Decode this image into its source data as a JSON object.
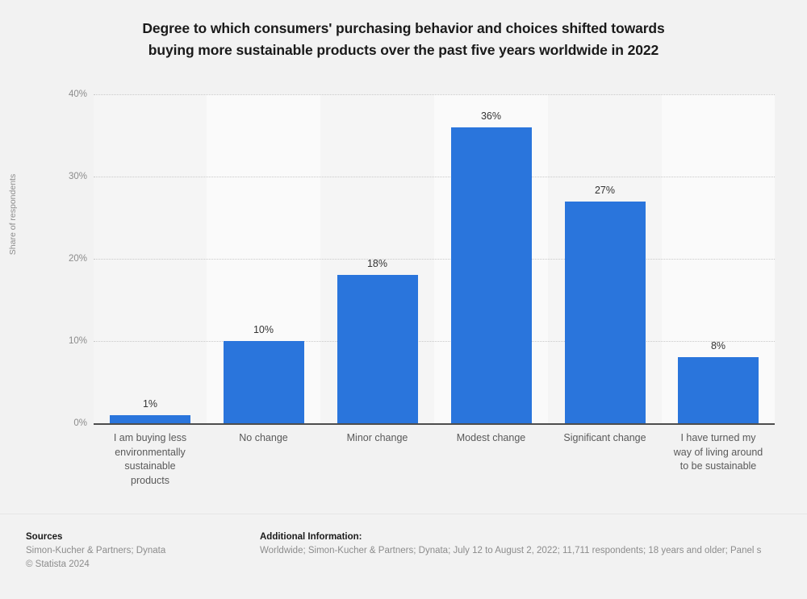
{
  "title": {
    "line1": "Degree to which consumers' purchasing behavior and choices shifted towards",
    "line2": "buying more sustainable products over the past five years worldwide in 2022"
  },
  "axis": {
    "y_title": "Share of respondents",
    "y_ticks": [
      "40%",
      "30%",
      "20%",
      "10%",
      "0%"
    ]
  },
  "bars": [
    {
      "label_line1": "I am buying less",
      "label_line2": "environmentally",
      "label_line3": "sustainable",
      "label_line4": "products",
      "value_label": "1%"
    },
    {
      "label_line1": "No change",
      "value_label": "10%"
    },
    {
      "label_line1": "Minor change",
      "value_label": "18%"
    },
    {
      "label_line1": "Modest change",
      "value_label": "36%"
    },
    {
      "label_line1": "Significant change",
      "value_label": "27%"
    },
    {
      "label_line1": "I have turned my",
      "label_line2": "way of living around",
      "label_line3": "to be sustainable",
      "value_label": "8%"
    }
  ],
  "footer": {
    "sources_heading": "Sources",
    "sources_text": "Simon-Kucher & Partners; Dynata",
    "copyright": "© Statista 2024",
    "additional_heading": "Additional Information:",
    "additional_text": "Worldwide; Simon-Kucher & Partners; Dynata; July 12 to August 2, 2022; 11,711 respondents; 18 years and older; Panel s"
  },
  "colors": {
    "bar": "#2a75dc",
    "background": "#f2f2f2",
    "band_a": "#f5f5f5",
    "band_b": "#fafafa",
    "axis": "#4d4d4d"
  },
  "chart_data": {
    "type": "bar",
    "title": "Degree to which consumers' purchasing behavior and choices shifted towards buying more sustainable products over the past five years worldwide in 2022",
    "categories": [
      "I am buying less environmentally sustainable products",
      "No change",
      "Minor change",
      "Modest change",
      "Significant change",
      "I have turned my way of living around to be sustainable"
    ],
    "values": [
      1,
      10,
      18,
      36,
      27,
      8
    ],
    "data_labels": [
      "1%",
      "10%",
      "18%",
      "36%",
      "27%",
      "8%"
    ],
    "xlabel": "",
    "ylabel": "Share of respondents",
    "ylim": [
      0,
      40
    ],
    "yticks": [
      0,
      10,
      20,
      30,
      40
    ],
    "ytick_labels": [
      "0%",
      "10%",
      "20%",
      "30%",
      "40%"
    ],
    "unit": "percent",
    "grid": true,
    "legend": false,
    "series_color": "#2a75dc"
  }
}
